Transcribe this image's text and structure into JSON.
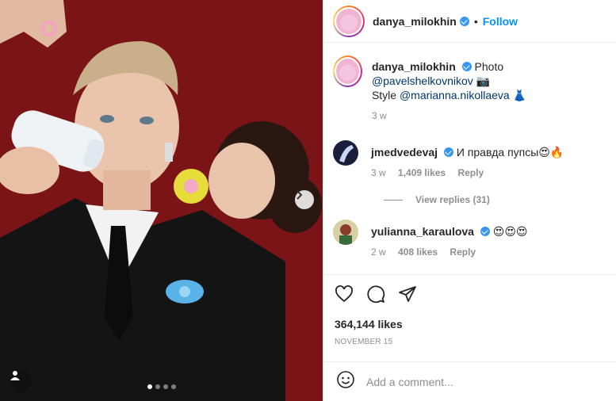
{
  "post": {
    "username": "danya_milokhin",
    "follow_label": "Follow",
    "bullet": "•"
  },
  "caption": {
    "username": "danya_milokhin",
    "text_before": "Photo",
    "mention1": "@pavelshelkovnikov",
    "emoji1": "📷",
    "style_label": "Style",
    "mention2": "@marianna.nikollaeva",
    "emoji2": "👗",
    "time": "3 w"
  },
  "comments": [
    {
      "username": "jmedvedevaj",
      "text": "И правда пупсы😍🔥",
      "time": "3 w",
      "likes": "1,409 likes",
      "reply_label": "Reply",
      "view_replies": "View replies (31)"
    },
    {
      "username": "yulianna_karaulova",
      "text": "😍😍😍",
      "time": "2 w",
      "likes": "408 likes",
      "reply_label": "Reply"
    }
  ],
  "likes_count": "364,144 likes",
  "date": "NOVEMBER 15",
  "add_comment": {
    "placeholder": "Add a comment..."
  },
  "carousel": {
    "total": 4,
    "active": 0
  },
  "icons": [
    "heart-icon",
    "comment-icon",
    "share-icon",
    "emoji-icon",
    "chevron-right-icon",
    "user-tag-icon",
    "verified-icon"
  ],
  "colors": {
    "accent": "#0095f6",
    "verified": "#3897f0",
    "photo_bg": "#7a1417"
  }
}
